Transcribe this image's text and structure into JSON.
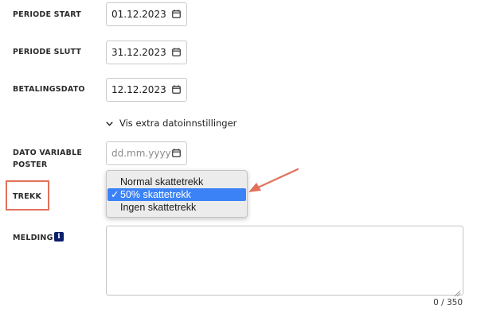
{
  "form": {
    "periode_start": {
      "label": "PERIODE START",
      "value": "01.12.2023"
    },
    "periode_slutt": {
      "label": "PERIODE SLUTT",
      "value": "31.12.2023"
    },
    "betalingsdato": {
      "label": "BETALINGSDATO",
      "value": "12.12.2023"
    },
    "extra_date_settings": {
      "label": "Vis extra datoinnstillinger"
    },
    "dato_variable_poster": {
      "label_line1": "DATO VARIABLE",
      "label_line2": "POSTER",
      "placeholder": "dd.mm.yyyy",
      "value": ""
    },
    "trekk": {
      "label": "TREKK",
      "options": [
        "Normal skattetrekk",
        "50% skattetrekk",
        "Ingen skattetrekk"
      ],
      "selected": "50% skattetrekk",
      "check_glyph": "✓"
    },
    "melding": {
      "label": "MELDING",
      "info_glyph": "i",
      "value": "",
      "counter": "0 / 350"
    }
  },
  "icons": {
    "calendar": "calendar-icon",
    "chevron": "chevron-down-icon",
    "info": "info-icon",
    "resize": "resize-grip-icon"
  },
  "colors": {
    "selection": "#3b82f7",
    "annotation": "#e2715a",
    "info_badge": "#0a1f6b"
  }
}
